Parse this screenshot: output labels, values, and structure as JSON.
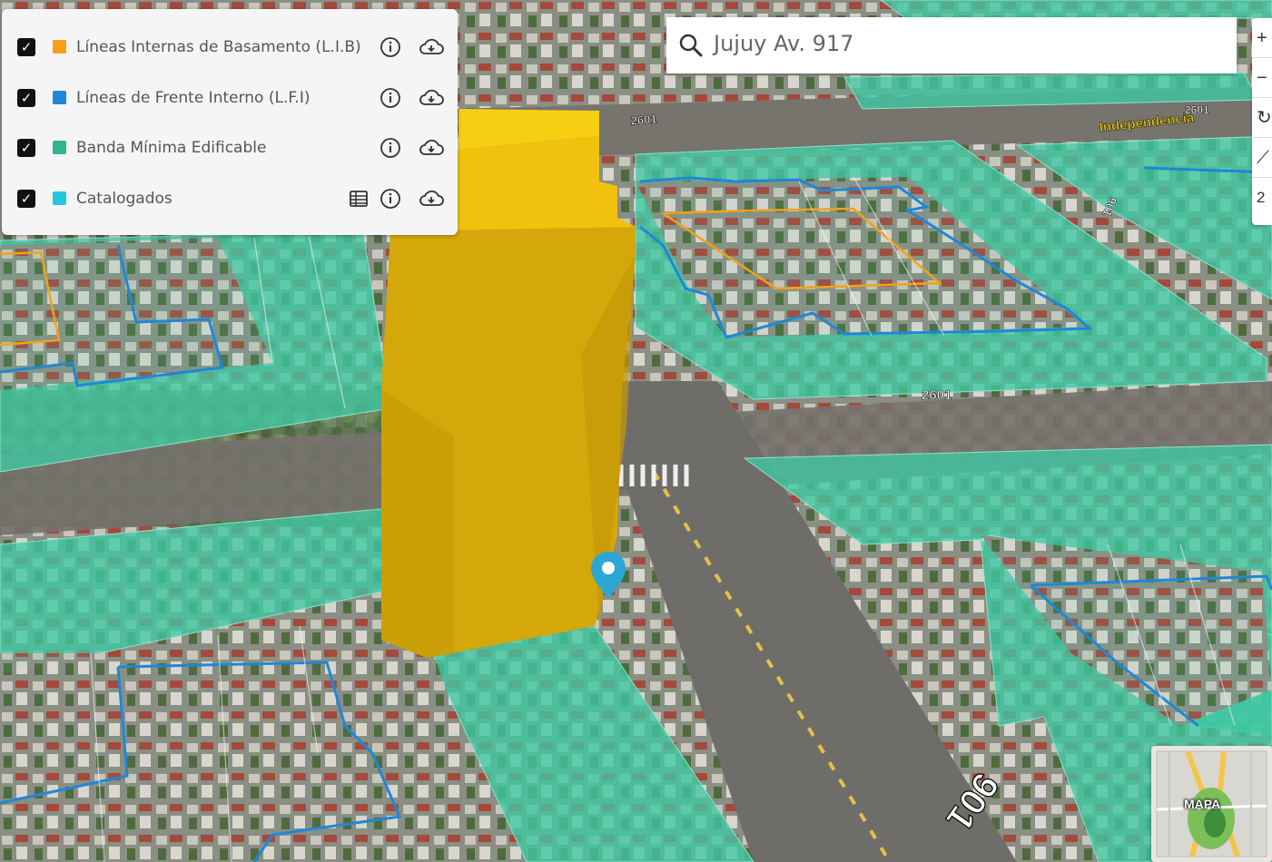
{
  "layers": [
    {
      "label": "Líneas Internas de Basamento (L.I.B)",
      "color": "#f5a01a",
      "checked": true,
      "table_icon": false
    },
    {
      "label": "Líneas de Frente Interno (L.F.I)",
      "color": "#1e88d6",
      "checked": true,
      "table_icon": false
    },
    {
      "label": "Banda Mínima Edificable",
      "color": "#33b38e",
      "checked": true,
      "table_icon": false
    },
    {
      "label": "Catalogados",
      "color": "#26c6e2",
      "checked": true,
      "table_icon": true
    }
  ],
  "search": {
    "value": "Jujuy Av. 917"
  },
  "map_labels": {
    "street_number_1": "2601",
    "street_number_2": "2601",
    "street_number_3": "2601",
    "street_number_4": "901",
    "street_number_5": "901",
    "street_name": "Independencia"
  },
  "controls": {
    "zoom_in": "+",
    "zoom_out": "−",
    "rotate": "↻",
    "measure": "⟋",
    "extra": "2"
  },
  "minimap": {
    "label": "MAPA"
  },
  "colors": {
    "band": "#3fc9a3",
    "lfi": "#1e88d6",
    "lib": "#f5a01a",
    "building": "#e2b100",
    "marker": "#2ba7d6"
  }
}
